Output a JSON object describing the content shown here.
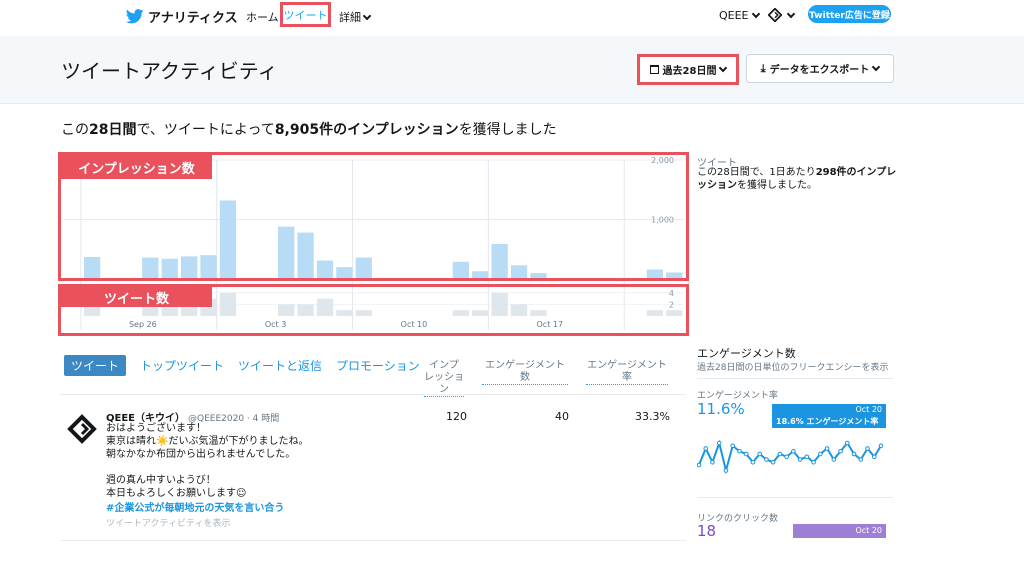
{
  "nav": {
    "brand": "アナリティクス",
    "home": "ホーム",
    "tweets": "ツイート",
    "more": "詳細",
    "account": "QEEE",
    "ad_button": "Twitter広告に登録"
  },
  "header": {
    "title": "ツイートアクティビティ",
    "period": "過去28日間",
    "export": "データをエクスポート"
  },
  "summary": {
    "prefix": "この",
    "days": "28日間",
    "middle": "で、ツイートによって",
    "count": "8,905件のインプレッション",
    "suffix": "を獲得しました"
  },
  "chart_labels": {
    "impressions": "インプレッション数",
    "tweets": "ツイート数"
  },
  "side": {
    "title": "ツイート",
    "text_pre": "この28日間で、1日あたり",
    "text_bold": "298件のインプレッション",
    "text_post": "を獲得しました。"
  },
  "chart_data": {
    "type": "bar",
    "x_tick_labels": [
      "Sep 26",
      "Oct 3",
      "Oct 10",
      "Oct 17"
    ],
    "impressions": {
      "yticks": [
        "2,000",
        "1,000"
      ],
      "ylim": [
        0,
        2000
      ],
      "values": [
        0,
        370,
        0,
        0,
        360,
        340,
        380,
        400,
        1320,
        0,
        0,
        880,
        780,
        310,
        200,
        360,
        0,
        0,
        0,
        0,
        290,
        130,
        590,
        230,
        100,
        0,
        0,
        0,
        0,
        0,
        160,
        110
      ]
    },
    "tweets": {
      "yticks": [
        "4",
        "2"
      ],
      "ylim": [
        0,
        5
      ],
      "values": [
        0,
        2,
        0,
        0,
        2,
        2,
        2,
        3,
        4,
        0,
        0,
        2,
        2,
        3,
        1,
        1,
        0,
        0,
        0,
        0,
        1,
        1,
        4,
        2,
        1,
        0,
        0,
        0,
        0,
        0,
        1,
        1
      ]
    }
  },
  "tabs": [
    "ツイート",
    "トップツイート",
    "ツイートと返信",
    "プロモーション"
  ],
  "columns": {
    "impressions_l1": "インプ",
    "impressions_l2": "レッション",
    "engagements": "エンゲージメント数",
    "rate": "エンゲージメント率"
  },
  "tweet": {
    "name": "QEEE（キウイ）",
    "meta": "@QEEE2020 · 4 時間",
    "lines": [
      "おはようございます！",
      "東京は晴れ☀️だいぶ気温が下がりましたね。",
      "朝なかなか布団から出られませんでした。",
      "",
      "週の真ん中すいようび！",
      "本日もよろしくお願いします☺"
    ],
    "hashtag": "#企業公式が毎朝地元の天気を言い合う",
    "activity_link": "ツイートアクティビティを表示",
    "impressions": "120",
    "engagements": "40",
    "rate": "33.3%"
  },
  "engagement_panel": {
    "title": "エンゲージメント数",
    "subtitle": "過去28日間の日単位のフリークエンシーを表示",
    "rate_label": "エンゲージメント率",
    "rate_value": "11.6%",
    "tooltip_date": "Oct 20",
    "tooltip_text": "18.6% エンゲージメント率",
    "rate_series": [
      8,
      14,
      9,
      16,
      6,
      15,
      13,
      12,
      9,
      12,
      10,
      9,
      12,
      11,
      13,
      10,
      11,
      9,
      12,
      14,
      10,
      13,
      16,
      12,
      10,
      14,
      11,
      15
    ],
    "clicks_label": "リンクのクリック数",
    "clicks_value": "18",
    "clicks_tooltip_date": "Oct 20"
  },
  "colors": {
    "accent": "#1da1f2",
    "highlight": "#e9525d",
    "impression_bar": "#b8dcf5",
    "tweet_bar": "#dfe6ec"
  }
}
